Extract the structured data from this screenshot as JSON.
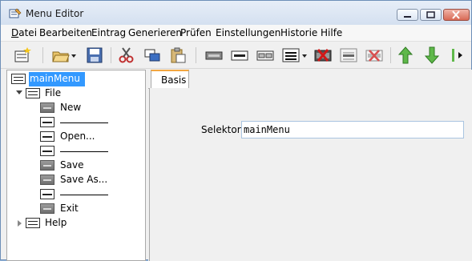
{
  "window": {
    "title": "Menu Editor"
  },
  "menubar": [
    {
      "label": "Datei",
      "accel": "D"
    },
    {
      "label": "Bearbeiten",
      "accel": ""
    },
    {
      "label": "Eintrag",
      "accel": ""
    },
    {
      "label": "Generieren",
      "accel": ""
    },
    {
      "label": "Prüfen",
      "accel": ""
    },
    {
      "label": "Einstellungen",
      "accel": ""
    },
    {
      "label": "Historie",
      "accel": ""
    },
    {
      "label": "Hilfe",
      "accel": ""
    }
  ],
  "toolbar": {
    "icons": [
      "new-menu-icon",
      "open-folder-icon",
      "save-icon",
      "cut-icon",
      "copy-icon",
      "paste-icon",
      "menu-item-icon",
      "separator-icon",
      "group-item-icon",
      "menu-dropdown-icon",
      "delete-item-icon",
      "move-item-icon",
      "remove-item-icon",
      "move-up-icon",
      "move-down-icon",
      "more-icon"
    ]
  },
  "tree": {
    "root": "mainMenu",
    "items": [
      {
        "label": "File",
        "level": 1
      },
      {
        "label": "New",
        "level": 2
      },
      {
        "label": "",
        "level": 2,
        "separator": true
      },
      {
        "label": "Open...",
        "level": 2
      },
      {
        "label": "",
        "level": 2,
        "separator": true
      },
      {
        "label": "Save",
        "level": 2
      },
      {
        "label": "Save As...",
        "level": 2
      },
      {
        "label": "",
        "level": 2,
        "separator": true
      },
      {
        "label": "Exit",
        "level": 2
      },
      {
        "label": "Help",
        "level": 1
      }
    ]
  },
  "details": {
    "tab": "Basis",
    "selector_label": "Selektor:",
    "selector_value": "mainMenu"
  },
  "colors": {
    "selection": "#3399ff",
    "tab_accent": "#f2a640"
  }
}
